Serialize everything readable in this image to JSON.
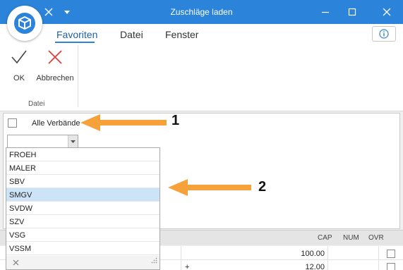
{
  "window": {
    "title": "Zuschläge laden"
  },
  "ribbon": {
    "tabs": [
      {
        "label": "Favoriten"
      },
      {
        "label": "Datei"
      },
      {
        "label": "Fenster"
      }
    ],
    "buttons": {
      "ok_label": "OK",
      "cancel_label": "Abbrechen"
    },
    "group_label": "Datei"
  },
  "filter": {
    "checkbox_label": "Alle Verbände",
    "checked": false,
    "combo_value": ""
  },
  "dropdown": {
    "items": [
      "FROEH",
      "MALER",
      "SBV",
      "SMGV",
      "SVDW",
      "SZV",
      "VSG",
      "VSSM"
    ],
    "selected": "SMGV"
  },
  "statusbar": {
    "cap": "CAP",
    "num": "NUM",
    "ovr": "OVR"
  },
  "grid": {
    "rows": [
      {
        "sign": "",
        "value": "100.00"
      },
      {
        "sign": "+",
        "value": "12.00"
      }
    ]
  },
  "annotations": {
    "badge1": "1",
    "badge2": "2"
  },
  "colors": {
    "accent": "#2b84d9",
    "arrow": "#f7a13a",
    "selected_row": "#cde3f7"
  }
}
